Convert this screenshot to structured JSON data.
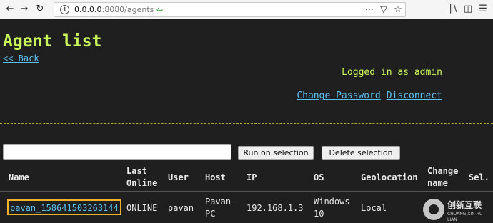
{
  "browser": {
    "url_host": "0.0.0.0",
    "url_path": ":8080/agents",
    "icons": {
      "back": "arrow-left-icon",
      "forward": "arrow-right-icon",
      "reload": "reload-icon",
      "home": "home-icon",
      "info": "info-icon",
      "redirect": "green-arrow-icon",
      "more": "ellipsis-icon",
      "pocket": "pocket-icon",
      "bookmark": "star-icon",
      "library": "library-icon",
      "sidebar": "sidebar-icon",
      "menu": "hamburger-icon"
    }
  },
  "page": {
    "title": "Agent list",
    "back_link": "<< Back",
    "logged_in": "Logged in as admin",
    "change_password": "Change Password",
    "disconnect": "Disconnect"
  },
  "actions": {
    "run_on_selection": "Run on selection",
    "delete_selection": "Delete selection"
  },
  "table": {
    "headers": {
      "name": "Name",
      "last_online_1": "Last",
      "last_online_2": "Online",
      "user": "User",
      "host": "Host",
      "ip": "IP",
      "os": "OS",
      "geolocation": "Geolocation",
      "change_name_1": "Change",
      "change_name_2": "name",
      "select": "Sel."
    },
    "rows": [
      {
        "name": "pavan_158641503263144",
        "last_online": "ONLINE",
        "user": "pavan",
        "host_1": "Pavan-",
        "host_2": "PC",
        "ip": "192.168.1.3",
        "os_1": "Windows",
        "os_2": "10",
        "geolocation": "Local"
      }
    ]
  },
  "watermark": {
    "brand": "创新互联",
    "sub": "CHUANG XIN HU LIAN"
  },
  "colors": {
    "background": "#1f1f1f",
    "title": "#c9f45a",
    "link": "#5cc0f2",
    "highlight_border": "#f2b22b",
    "divider": "#b3a636"
  }
}
